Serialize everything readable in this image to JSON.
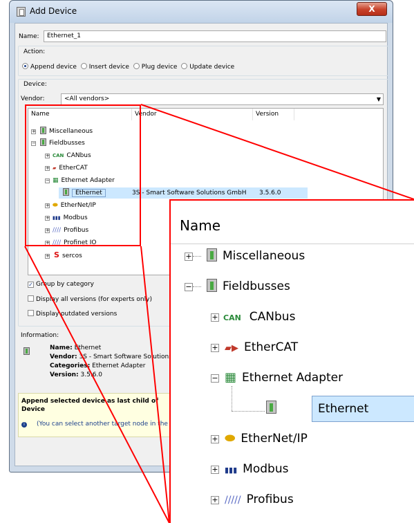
{
  "window": {
    "title": "Add Device",
    "close_label": "X"
  },
  "name_field": {
    "label": "Name:",
    "value": "Ethernet_1"
  },
  "action": {
    "label": "Action:",
    "options": [
      {
        "label": "Append device",
        "selected": true
      },
      {
        "label": "Insert device",
        "selected": false
      },
      {
        "label": "Plug device",
        "selected": false
      },
      {
        "label": "Update device",
        "selected": false
      }
    ]
  },
  "device": {
    "label": "Device:"
  },
  "vendor": {
    "label": "Vendor:",
    "value": "<All vendors>"
  },
  "tree": {
    "columns": [
      "Name",
      "Vendor",
      "Version"
    ],
    "rows": [
      {
        "label": "Miscellaneous",
        "icon": "device-icon"
      },
      {
        "label": "Fieldbusses",
        "icon": "device-icon"
      },
      {
        "label": "CANbus",
        "icon": "canbus-icon"
      },
      {
        "label": "EtherCAT",
        "icon": "ethercat-icon"
      },
      {
        "label": "Ethernet Adapter",
        "icon": "ethernet-adapter-icon"
      },
      {
        "label": "Ethernet",
        "icon": "device-icon",
        "vendor": "3S - Smart Software Solutions GmbH",
        "version": "3.5.6.0",
        "selected": true
      },
      {
        "label": "EtherNet/IP",
        "icon": "ethernet-ip-icon"
      },
      {
        "label": "Modbus",
        "icon": "modbus-icon"
      },
      {
        "label": "Profibus",
        "icon": "profibus-icon"
      },
      {
        "label": "Profinet IO",
        "icon": "profinet-icon"
      },
      {
        "label": "sercos",
        "icon": "sercos-icon"
      }
    ]
  },
  "options": {
    "group_by_category": {
      "label": "Group by category",
      "checked": true
    },
    "display_all_versions": {
      "label": "Display all versions (for experts only)",
      "checked": false
    },
    "display_outdated": {
      "label": "Display outdated versions",
      "checked": false
    }
  },
  "information": {
    "label": "Information:",
    "name_key": "Name:",
    "name_val": "Ethernet",
    "vendor_key": "Vendor:",
    "vendor_val": "3S - Smart Software Solutions GmbH",
    "categories_key": "Categories:",
    "categories_val": "Ethernet Adapter",
    "version_key": "Version:",
    "version_val": "3.5.6.0"
  },
  "hint": {
    "title": "Append selected device as last child of",
    "target": "Device",
    "note": "(You can select another target node in the n"
  },
  "zoom": {
    "header": "Name",
    "rows": [
      "Miscellaneous",
      "Fieldbusses",
      "CANbus",
      "EtherCAT",
      "Ethernet Adapter",
      "Ethernet",
      "EtherNet/IP",
      "Modbus",
      "Profibus"
    ]
  },
  "colors": {
    "highlight": "#cce8ff",
    "red": "#ff0000"
  }
}
